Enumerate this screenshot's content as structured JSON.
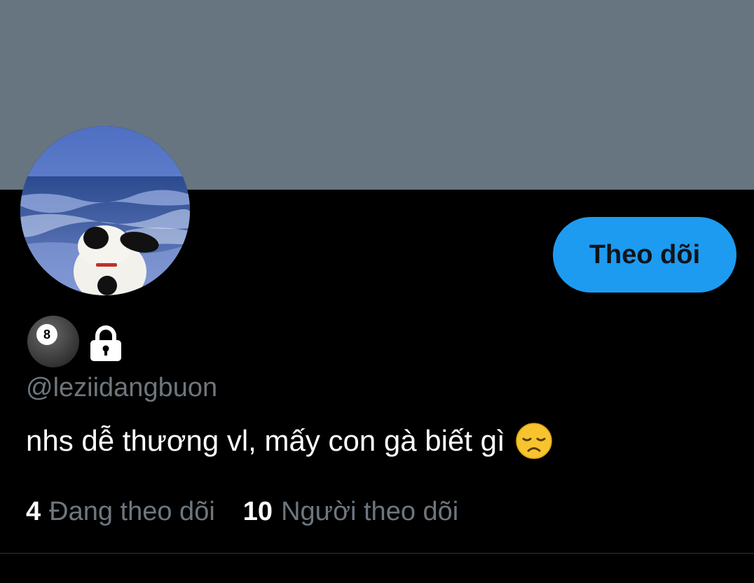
{
  "profile": {
    "display_name_icons": [
      "8-ball-icon",
      "lock-icon"
    ],
    "handle": "@leziidangbuon",
    "bio_text": "nhs dễ thương vl, mấy con gà biết gì",
    "bio_emoji": "disappointed-face-icon"
  },
  "actions": {
    "follow_label": "Theo dõi"
  },
  "stats": {
    "following_count": "4",
    "following_label": "Đang theo dõi",
    "followers_count": "10",
    "followers_label": "Người theo dõi"
  },
  "colors": {
    "banner": "#66757f",
    "accent": "#1d9bf0",
    "background": "#000000",
    "secondary_text": "#6e767d"
  }
}
